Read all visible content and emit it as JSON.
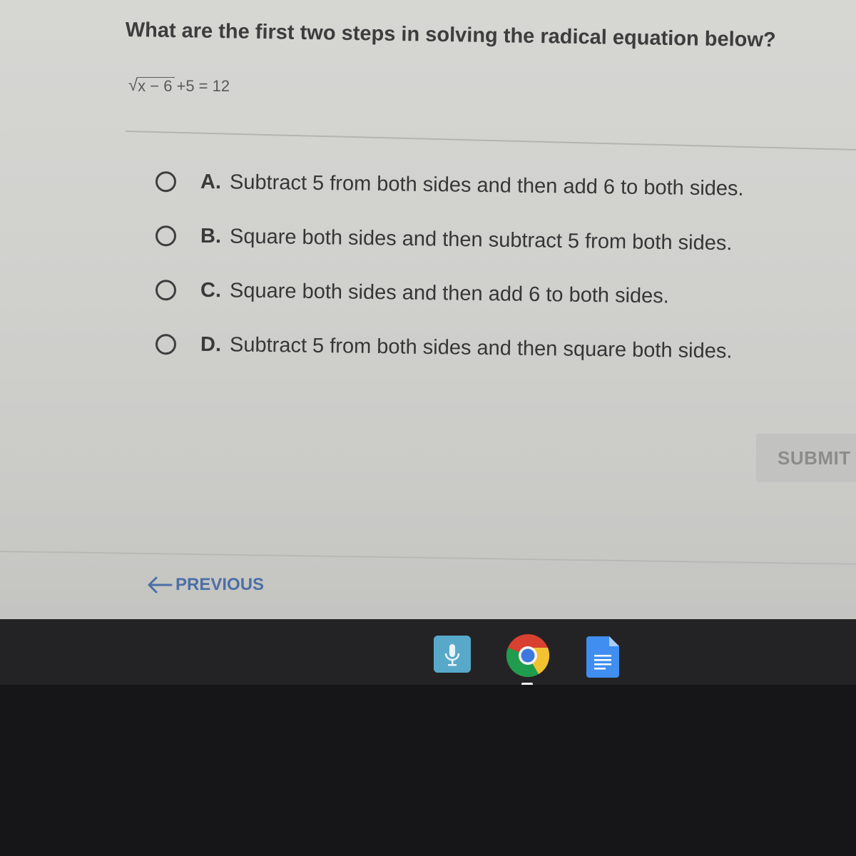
{
  "question": {
    "prompt": "What are the first two steps in solving the radical equation below?",
    "equation": {
      "radicand": "x − 6",
      "rest": "+5 = 12"
    }
  },
  "options": [
    {
      "letter": "A.",
      "text": "Subtract 5 from both sides and then add 6 to both sides.",
      "selected": false
    },
    {
      "letter": "B.",
      "text": "Square both sides and then subtract 5 from both sides.",
      "selected": false
    },
    {
      "letter": "C.",
      "text": "Square both sides and then add 6 to both sides.",
      "selected": false
    },
    {
      "letter": "D.",
      "text": "Subtract 5 from both sides and then square both sides.",
      "selected": false
    }
  ],
  "actions": {
    "submit_label": "SUBMIT",
    "previous_label": "PREVIOUS"
  },
  "shelf": {
    "apps": [
      "microphone-app-icon",
      "chrome-icon",
      "docs-icon"
    ]
  },
  "colors": {
    "link": "#4c6fa5",
    "submit_bg": "#c2c2c0",
    "submit_text": "#8c8c8c",
    "page_bg": "#d3d3d0",
    "shelf_bg": "#232325"
  }
}
